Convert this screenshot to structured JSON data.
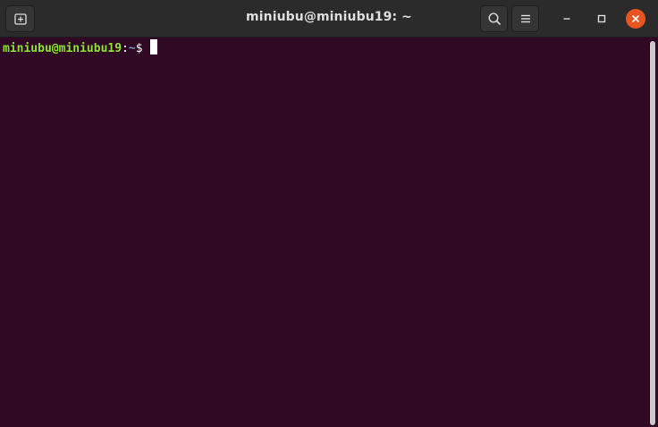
{
  "window": {
    "title": "miniubu@miniubu19: ~"
  },
  "titlebar": {
    "new_tab_icon": "new-tab-icon",
    "search_icon": "search-icon",
    "menu_icon": "hamburger-menu-icon",
    "minimize_icon": "minimize-icon",
    "maximize_icon": "maximize-icon",
    "close_icon": "close-icon"
  },
  "terminal": {
    "prompt_user_host": "miniubu@miniubu19",
    "prompt_colon": ":",
    "prompt_path": "~",
    "prompt_symbol": "$"
  },
  "colors": {
    "terminal_background": "#300a24",
    "titlebar_background": "#2b2b2b",
    "close_button": "#e95420",
    "prompt_user_host": "#8ae234",
    "prompt_path": "#729fcf"
  }
}
